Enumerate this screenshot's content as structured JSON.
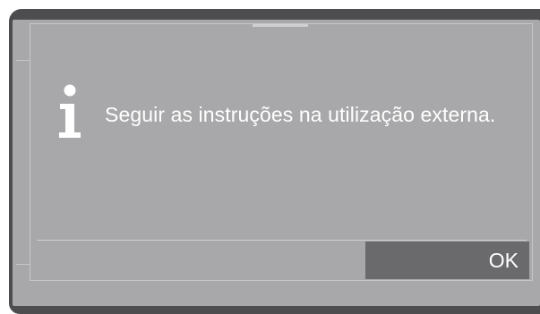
{
  "dialog": {
    "icon": "info-icon",
    "message": "Seguir as instruções na utilização externa.",
    "ok_label": "OK"
  },
  "colors": {
    "bezel": "#4d4d4f",
    "screen": "#a8a8aa",
    "button": "#6a6a6c",
    "text": "#ffffff"
  }
}
